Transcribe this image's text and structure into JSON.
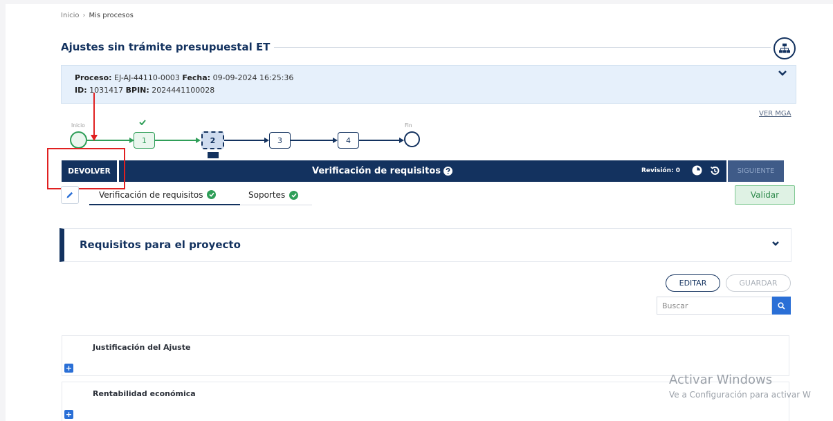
{
  "breadcrumb": {
    "home": "Inicio",
    "separator": "›",
    "current": "Mis procesos"
  },
  "page_title": "Ajustes sin trámite presupuestal ET",
  "info": {
    "proceso_label": "Proceso:",
    "proceso_value": "EJ-AJ-44110-0003",
    "fecha_label": "Fecha:",
    "fecha_value": "09-09-2024 16:25:36",
    "id_label": "ID:",
    "id_value": "1031417",
    "bpin_label": "BPIN:",
    "bpin_value": "2024441100028"
  },
  "links": {
    "ver_mga": "VER MGA"
  },
  "stepper": {
    "start_label": "Inicio",
    "end_label": "Fin",
    "steps": [
      "1",
      "2",
      "3",
      "4"
    ],
    "current_step": 2,
    "colors": {
      "done": "#2f9e58",
      "current": "#13325f",
      "pending": "#13325f"
    }
  },
  "action_bar": {
    "devolver": "DEVOLVER",
    "title": "Verificación de requisitos",
    "revision_label": "Revisión: 0",
    "siguiente": "SIGUIENTE"
  },
  "tabs": [
    {
      "label": "Verificación de requisitos",
      "status": "check-circle-icon"
    },
    {
      "label": "Soportes",
      "status": "check-circle-icon"
    }
  ],
  "validar": "Validar",
  "section": {
    "title": "Requisitos para el proyecto"
  },
  "toolbar": {
    "editar": "EDITAR",
    "guardar": "GUARDAR",
    "search_placeholder": "Buscar"
  },
  "requirements": [
    {
      "label": "Justificación del Ajuste"
    },
    {
      "label": "Rentabilidad económica"
    }
  ],
  "watermark": {
    "line1": "Activar Windows",
    "line2": "Ve a Configuración para activar W"
  },
  "colors": {
    "brand": "#13325f",
    "success": "#2f9e58",
    "annotation": "#e02020",
    "accent": "#2a6fd6"
  }
}
